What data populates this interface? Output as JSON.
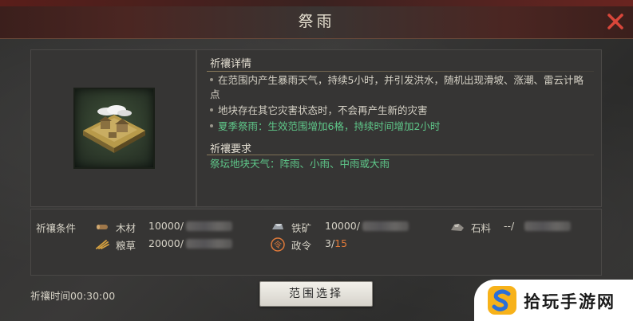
{
  "header": {
    "title": "祭雨"
  },
  "close": {
    "icon": "close-icon",
    "color": "#d9463a"
  },
  "building": {
    "icon": "altar-building-icon"
  },
  "details": {
    "title": "祈禳详情",
    "lines": [
      "在范围内产生暴雨天气，持续5小时，并引发洪水，随机出现滑坡、涨潮、雷云计略点",
      "地块存在其它灾害状态时，不会再产生新的灾害",
      "夏季祭雨：生效范围增加6格，持续时间增加2小时"
    ]
  },
  "requirements": {
    "title": "祈禳要求",
    "text": "祭坛地块天气：阵雨、小雨、中雨或大雨"
  },
  "conditions": {
    "label": "祈禳条件",
    "resources": [
      {
        "name": "木材",
        "value": "10000/",
        "icon": "wood-icon"
      },
      {
        "name": "铁矿",
        "value": "10000/",
        "icon": "iron-icon"
      },
      {
        "name": "石料",
        "value": "--/",
        "icon": "stone-icon"
      },
      {
        "name": "粮草",
        "value": "20000/",
        "icon": "grain-icon"
      },
      {
        "name": "政令",
        "value_current": "3/",
        "value_max": "15",
        "icon": "decree-icon"
      }
    ]
  },
  "footer": {
    "time_label": "祈禳时间",
    "time_value": "00:30:00",
    "range_button": "范围选择"
  },
  "watermark": {
    "text": "拾玩手游网",
    "icon": "logo-icon"
  },
  "colors": {
    "green": "#5fc88a",
    "accent": "#e07a3a",
    "title_bar": "#4b2622"
  }
}
